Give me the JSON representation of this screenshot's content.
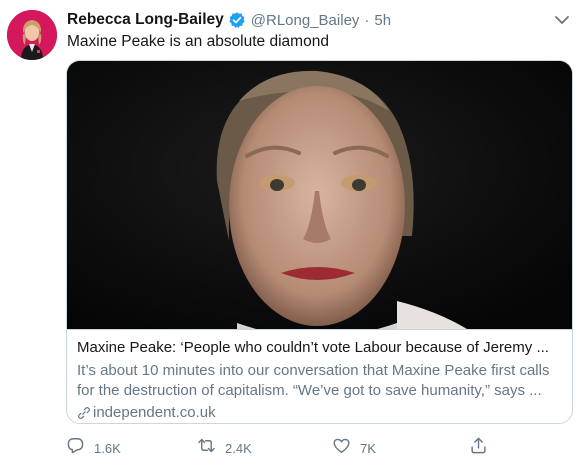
{
  "tweet": {
    "author": {
      "display_name": "Rebecca Long-Bailey",
      "handle": "@RLong_Bailey",
      "verified": true
    },
    "separator": "·",
    "time": "5h",
    "text": "Maxine Peake is an absolute diamond"
  },
  "card": {
    "title": "Maxine Peake: ‘People who couldn’t vote Labour because of Jeremy ...",
    "description_line1": "It’s about 10 minutes into our conversation that Maxine Peake first calls",
    "description_line2": "for the destruction of capitalism. “We’ve got to save humanity,” says ...",
    "domain": "independent.co.uk"
  },
  "actions": {
    "reply_count": "1.6K",
    "retweet_count": "2.4K",
    "like_count": "7K"
  },
  "colors": {
    "accent": "#1da1f2",
    "secondary_text": "#657786",
    "border": "#ccd6dd"
  },
  "icons": [
    "verified-badge-icon",
    "chevron-down-icon",
    "link-icon",
    "reply-icon",
    "retweet-icon",
    "like-icon",
    "share-icon"
  ]
}
